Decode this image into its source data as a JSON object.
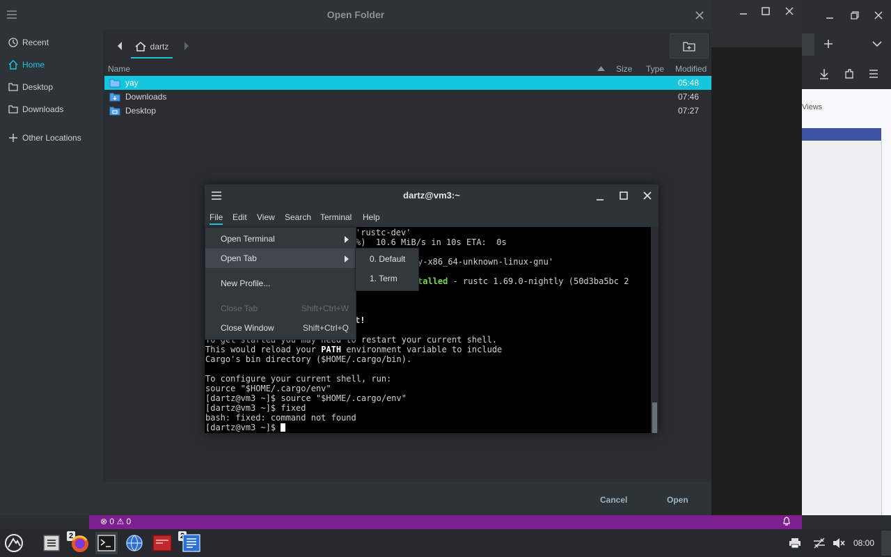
{
  "dialog": {
    "title": "Open Folder",
    "sidebar": [
      {
        "label": "Recent",
        "icon": "clock-icon"
      },
      {
        "label": "Home",
        "icon": "home-icon",
        "active": true
      },
      {
        "label": "Desktop",
        "icon": "folder-icon"
      },
      {
        "label": "Downloads",
        "icon": "folder-icon"
      },
      {
        "label": "Other Locations",
        "icon": "plus-icon"
      }
    ],
    "breadcrumb": {
      "current": "dartz"
    },
    "columns": {
      "name": "Name",
      "size": "Size",
      "type": "Type",
      "modified": "Modified"
    },
    "files": [
      {
        "name": "yay",
        "modified": "05:48",
        "selected": true
      },
      {
        "name": "Downloads",
        "modified": "07:46"
      },
      {
        "name": "Desktop",
        "modified": "07:27"
      }
    ],
    "buttons": {
      "cancel": "Cancel",
      "open": "Open"
    }
  },
  "terminal": {
    "title": "dartz@vm3:~",
    "menu": [
      "File",
      "Edit",
      "View",
      "Search",
      "Terminal",
      "Help"
    ],
    "lines": [
      "'rustc-dev'",
      "%)  10.6 MiB/s in 10s ETA:  0s",
      "",
      "y-x86_64-unknown-linux-gnu'",
      "",
      "talled",
      "",
      "",
      "",
      "t!",
      "",
      "To get started you may need to restart your current shell.",
      "This would reload your",
      "Cargo's bin directory ($HOME/.cargo/bin).",
      "",
      "To configure your current shell, run:",
      "source \"$HOME/.cargo/env\"",
      "[dartz@vm3 ~]$ source \"$HOME/.cargo/env\"",
      "[dartz@vm3 ~]$ fixed",
      "bash: fixed: command not found",
      "[dartz@vm3 ~]$ "
    ],
    "installed_suffix": " - rustc 1.69.0-nightly (50d3ba5bc 2",
    "path_word": "PATH",
    "path_suffix": " environment variable to include"
  },
  "file_menu": {
    "items": [
      {
        "label": "Open Terminal",
        "submenu": true
      },
      {
        "label": "Open Tab",
        "submenu": true,
        "highlighted": true
      },
      {
        "label": "New Profile..."
      },
      {
        "label": "Close Tab",
        "shortcut": "Shift+Ctrl+W",
        "disabled": true
      },
      {
        "label": "Close Window",
        "shortcut": "Shift+Ctrl+Q"
      }
    ],
    "open_tab_submenu": [
      "0. Default",
      "1. Term"
    ]
  },
  "statusbar": {
    "errors": "0",
    "warnings": "0"
  },
  "browser_fragment": "Views",
  "taskbar": {
    "badges": [
      "2",
      "2"
    ],
    "clock": "08:00"
  },
  "colors": {
    "accent": "#1fc4de",
    "statusbar": "#7e1f8f"
  }
}
